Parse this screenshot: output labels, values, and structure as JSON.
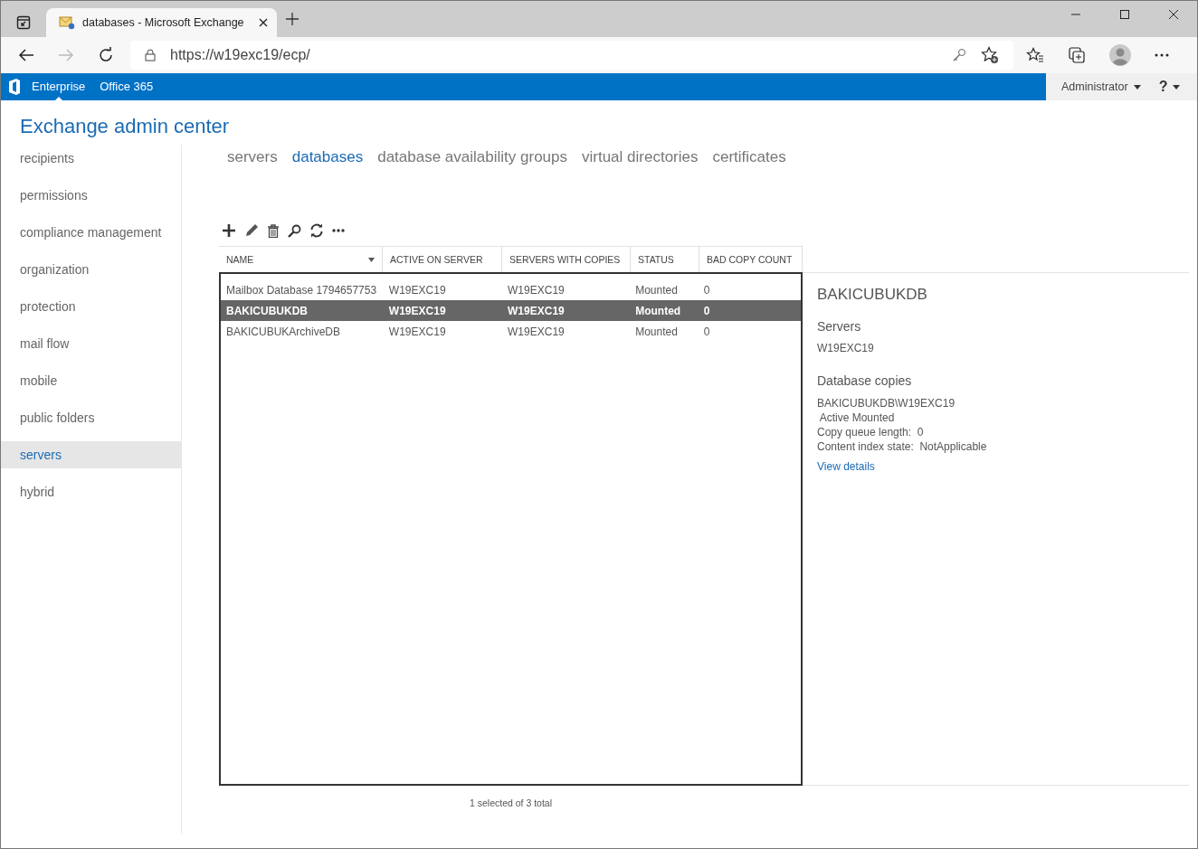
{
  "browser": {
    "tab_title": "databases - Microsoft Exchange",
    "url": "https://w19exc19/ecp/"
  },
  "top_nav": {
    "items": [
      {
        "label": "Enterprise",
        "selected": true
      },
      {
        "label": "Office 365",
        "selected": false
      }
    ],
    "user": "Administrator",
    "help": "?"
  },
  "title": "Exchange admin center",
  "sidebar": {
    "items": [
      {
        "label": "recipients",
        "selected": false
      },
      {
        "label": "permissions",
        "selected": false
      },
      {
        "label": "compliance management",
        "selected": false
      },
      {
        "label": "organization",
        "selected": false
      },
      {
        "label": "protection",
        "selected": false
      },
      {
        "label": "mail flow",
        "selected": false
      },
      {
        "label": "mobile",
        "selected": false
      },
      {
        "label": "public folders",
        "selected": false
      },
      {
        "label": "servers",
        "selected": true
      },
      {
        "label": "hybrid",
        "selected": false
      }
    ]
  },
  "subtabs": [
    {
      "label": "servers",
      "selected": false
    },
    {
      "label": "databases",
      "selected": true
    },
    {
      "label": "database availability groups",
      "selected": false
    },
    {
      "label": "virtual directories",
      "selected": false
    },
    {
      "label": "certificates",
      "selected": false
    }
  ],
  "table": {
    "columns": [
      {
        "label": "NAME",
        "has_menu": true
      },
      {
        "label": "ACTIVE ON SERVER",
        "has_menu": false
      },
      {
        "label": "SERVERS WITH COPIES",
        "has_menu": false
      },
      {
        "label": "STATUS",
        "has_menu": false
      },
      {
        "label": "BAD COPY COUNT",
        "has_menu": false
      }
    ],
    "rows": [
      {
        "cells": [
          "Mailbox Database 1794657753",
          "W19EXC19",
          "W19EXC19",
          "Mounted",
          "0"
        ],
        "selected": false
      },
      {
        "cells": [
          "BAKICUBUKDB",
          "W19EXC19",
          "W19EXC19",
          "Mounted",
          "0"
        ],
        "selected": true
      },
      {
        "cells": [
          "BAKICUBUKArchiveDB",
          "W19EXC19",
          "W19EXC19",
          "Mounted",
          "0"
        ],
        "selected": false
      }
    ]
  },
  "status": "1 selected of 3 total",
  "details": {
    "title": "BAKICUBUKDB",
    "servers_heading": "Servers",
    "servers": "W19EXC19",
    "copies_heading": "Database copies",
    "copy_lines": [
      "BAKICUBUKDB\\W19EXC19",
      " Active Mounted",
      "Copy queue length:  0",
      "Content index state:  NotApplicable"
    ],
    "link": "View details"
  }
}
